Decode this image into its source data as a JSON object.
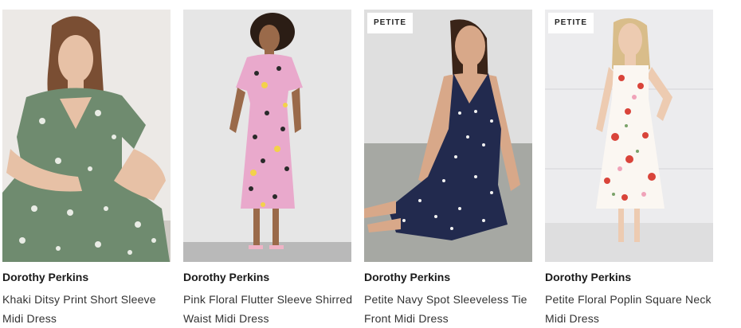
{
  "products": [
    {
      "brand": "Dorothy Perkins",
      "title": "Khaki Ditsy Print Short Sleeve Midi Dress",
      "badge": "",
      "image_icon": "khaki-dress-photo",
      "colors": {
        "bg": "#ece9e6",
        "dress": "#6f8b6f",
        "print": "#e9ece5",
        "hair": "#7a4e33",
        "skin": "#e7c1a6"
      }
    },
    {
      "brand": "Dorothy Perkins",
      "title": "Pink Floral Flutter Sleeve Shirred Waist Midi Dress",
      "badge": "",
      "image_icon": "pink-floral-dress-photo",
      "colors": {
        "bg": "#e6e6e6",
        "dress": "#e9a9cc",
        "print": "#2a2a2a",
        "hair": "#2b1d15",
        "skin": "#9a6a4a"
      }
    },
    {
      "brand": "Dorothy Perkins",
      "title": "Petite Navy Spot Sleeveless Tie Front Midi Dress",
      "badge": "PETITE",
      "image_icon": "navy-spot-dress-photo",
      "colors": {
        "bg": "#dfdfdf",
        "dress": "#222a4e",
        "print": "#f2f2f2",
        "hair": "#3a2418",
        "skin": "#d8a889"
      }
    },
    {
      "brand": "Dorothy Perkins",
      "title": "Petite Floral Poplin Square Neck Midi Dress",
      "badge": "PETITE",
      "image_icon": "floral-poplin-dress-photo",
      "colors": {
        "bg": "#ececee",
        "dress": "#fbf7f2",
        "print": "#d9443a",
        "hair": "#d9bd8a",
        "skin": "#edcbb1"
      }
    }
  ]
}
